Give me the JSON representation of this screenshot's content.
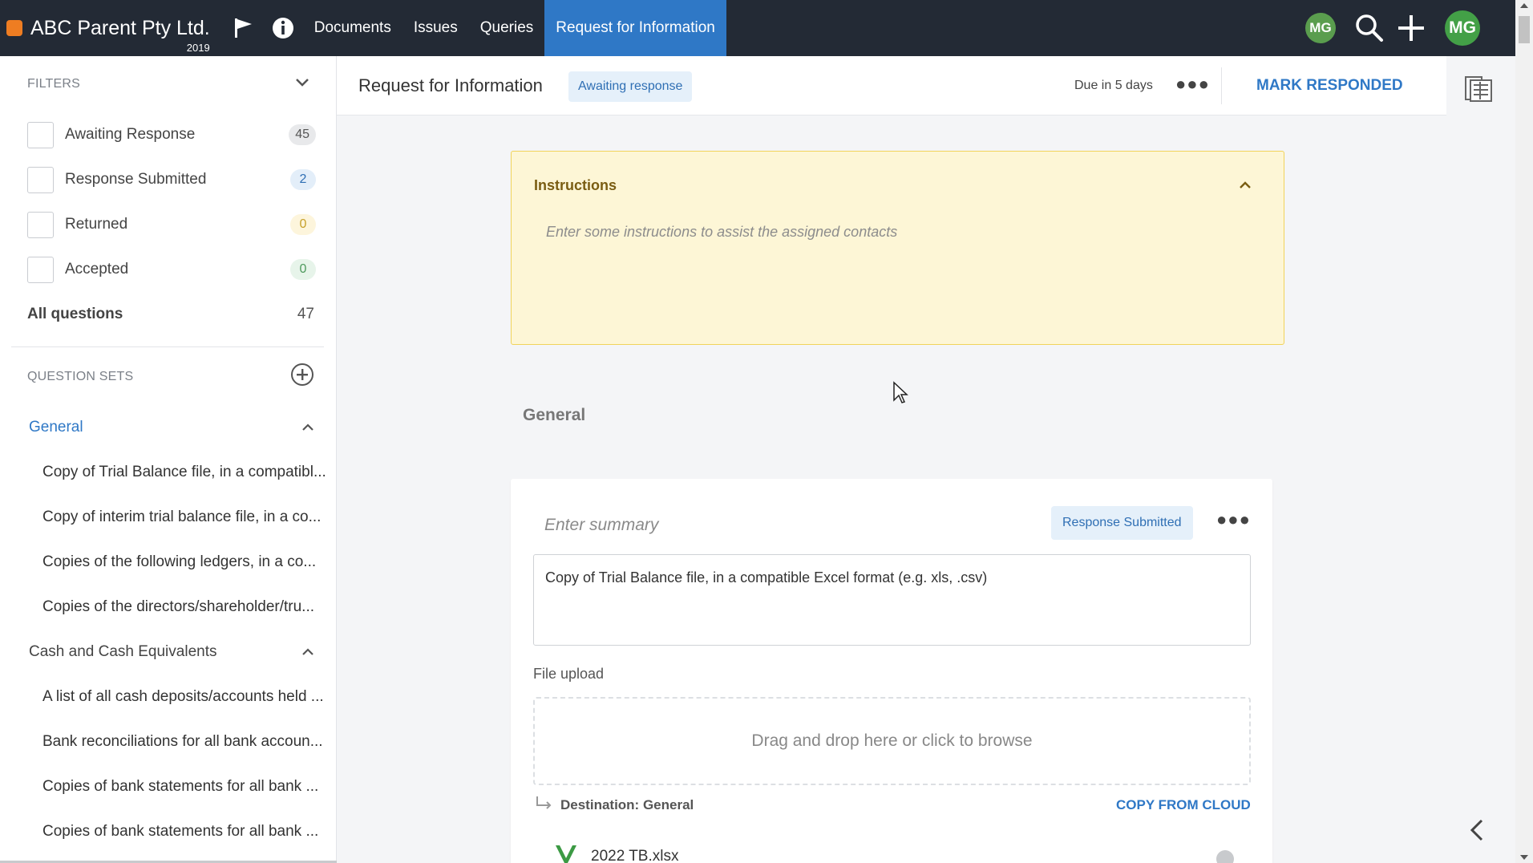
{
  "app": {
    "company": "ABC Parent Pty Ltd.",
    "year": "2019"
  },
  "nav": {
    "items": [
      {
        "label": "Documents"
      },
      {
        "label": "Issues"
      },
      {
        "label": "Queries"
      },
      {
        "label": "Request for Information"
      }
    ],
    "active": "Request for Information",
    "avatar_small": "MG",
    "avatar_large": "MG"
  },
  "sidebar": {
    "filters_label": "FILTERS",
    "filters": [
      {
        "label": "Awaiting Response",
        "count": "45",
        "color": "#e8e9eb"
      },
      {
        "label": "Response Submitted",
        "count": "2",
        "color": "#e3eef9"
      },
      {
        "label": "Returned",
        "count": "0",
        "color": "#fdf5dc"
      },
      {
        "label": "Accepted",
        "count": "0",
        "color": "#e7f4ea"
      }
    ],
    "all_questions_label": "All questions",
    "all_questions_count": "47",
    "question_sets_label": "QUESTION SETS",
    "groups": [
      {
        "label": "General",
        "items": [
          "Copy of Trial Balance file, in a compatibl...",
          "Copy of interim trial balance file, in a co...",
          "Copies of the following ledgers, in a co...",
          "Copies of the directors/shareholder/tru..."
        ]
      },
      {
        "label": "Cash and Cash Equivalents",
        "items": [
          "A list of all cash deposits/accounts held ...",
          "Bank reconciliations for all bank accoun...",
          "Copies of bank statements for all bank ...",
          "Copies of bank statements for all bank ..."
        ]
      }
    ]
  },
  "header": {
    "title": "Request for Information",
    "status": "Awaiting response",
    "due": "Due in 5 days",
    "mark_responded": "MARK RESPONDED"
  },
  "instructions": {
    "title": "Instructions",
    "placeholder": "Enter some instructions to assist the assigned contacts"
  },
  "section": {
    "title": "General"
  },
  "question_card": {
    "summary_placeholder": "Enter summary",
    "status": "Response Submitted",
    "question": "Copy of Trial Balance file, in a compatible Excel format (e.g. xls, .csv)",
    "file_upload_label": "File upload",
    "dropzone_text": "Drag and drop here or click to browse",
    "destination": "Destination: General",
    "copy_from_cloud": "COPY FROM CLOUD",
    "file_name": "2022 TB.xlsx"
  },
  "colors": {
    "nav_bg": "#232a35",
    "accent": "#2f78c6",
    "brand": "#ee7d22",
    "instructions_bg": "#fdf6d6"
  }
}
